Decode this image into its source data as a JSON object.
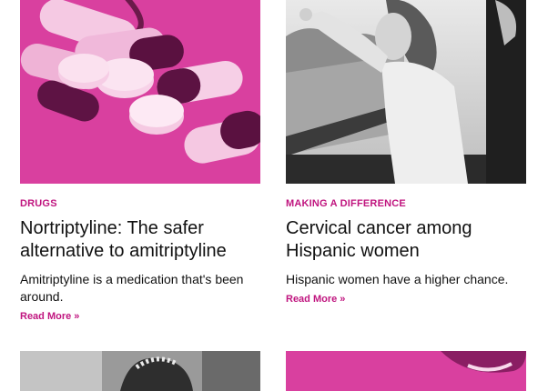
{
  "cards": [
    {
      "category": "DRUGS",
      "title": "Nortriptyline: The safer alternative to amitriptyline",
      "description": "Amitriptyline is a medication that's been around.",
      "read_more": "Read More »",
      "image": "pills-photo"
    },
    {
      "category": "MAKING A DIFFERENCE",
      "title": "Cervical cancer among Hispanic women",
      "description": "Hispanic women have a higher chance.",
      "read_more": "Read More »",
      "image": "woman-pointing-photo"
    }
  ],
  "bottom_images": [
    "portrait-photo",
    "pink-portrait-photo"
  ],
  "colors": {
    "accent": "#c0157f",
    "pink_tint": "#d9409f"
  }
}
